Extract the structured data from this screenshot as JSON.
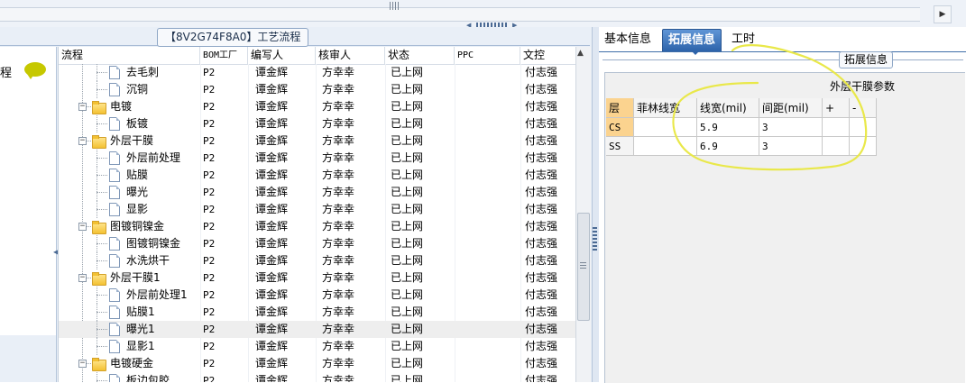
{
  "left_panel": {
    "title": "【8V2G74F8A0】工艺流程",
    "side_text": "程"
  },
  "grid": {
    "columns": [
      "流程",
      "BOM工厂",
      "编写人",
      "核审人",
      "状态",
      "PPC",
      "文控"
    ],
    "rows": [
      {
        "name": "去毛刺",
        "level": 2,
        "kind": "doc",
        "bom": "P2",
        "writer": "谭金辉",
        "reviewer": "方幸幸",
        "status": "已上网",
        "ppc": "",
        "control": "付志强"
      },
      {
        "name": "沉铜",
        "level": 2,
        "kind": "doc",
        "bom": "P2",
        "writer": "谭金辉",
        "reviewer": "方幸幸",
        "status": "已上网",
        "ppc": "",
        "control": "付志强"
      },
      {
        "name": "电镀",
        "level": 1,
        "kind": "folder",
        "bom": "P2",
        "writer": "谭金辉",
        "reviewer": "方幸幸",
        "status": "已上网",
        "ppc": "",
        "control": "付志强"
      },
      {
        "name": "板镀",
        "level": 2,
        "kind": "doc",
        "bom": "P2",
        "writer": "谭金辉",
        "reviewer": "方幸幸",
        "status": "已上网",
        "ppc": "",
        "control": "付志强"
      },
      {
        "name": "外层干膜",
        "level": 1,
        "kind": "folder",
        "bom": "P2",
        "writer": "谭金辉",
        "reviewer": "方幸幸",
        "status": "已上网",
        "ppc": "",
        "control": "付志强"
      },
      {
        "name": "外层前处理",
        "level": 2,
        "kind": "doc",
        "bom": "P2",
        "writer": "谭金辉",
        "reviewer": "方幸幸",
        "status": "已上网",
        "ppc": "",
        "control": "付志强"
      },
      {
        "name": "贴膜",
        "level": 2,
        "kind": "doc",
        "bom": "P2",
        "writer": "谭金辉",
        "reviewer": "方幸幸",
        "status": "已上网",
        "ppc": "",
        "control": "付志强"
      },
      {
        "name": "曝光",
        "level": 2,
        "kind": "doc",
        "bom": "P2",
        "writer": "谭金辉",
        "reviewer": "方幸幸",
        "status": "已上网",
        "ppc": "",
        "control": "付志强"
      },
      {
        "name": "显影",
        "level": 2,
        "kind": "doc",
        "bom": "P2",
        "writer": "谭金辉",
        "reviewer": "方幸幸",
        "status": "已上网",
        "ppc": "",
        "control": "付志强"
      },
      {
        "name": "图镀铜镍金",
        "level": 1,
        "kind": "folder",
        "bom": "P2",
        "writer": "谭金辉",
        "reviewer": "方幸幸",
        "status": "已上网",
        "ppc": "",
        "control": "付志强"
      },
      {
        "name": "图镀铜镍金",
        "level": 2,
        "kind": "doc",
        "bom": "P2",
        "writer": "谭金辉",
        "reviewer": "方幸幸",
        "status": "已上网",
        "ppc": "",
        "control": "付志强"
      },
      {
        "name": "水洗烘干",
        "level": 2,
        "kind": "doc",
        "bom": "P2",
        "writer": "谭金辉",
        "reviewer": "方幸幸",
        "status": "已上网",
        "ppc": "",
        "control": "付志强"
      },
      {
        "name": "外层干膜1",
        "level": 1,
        "kind": "folder",
        "bom": "P2",
        "writer": "谭金辉",
        "reviewer": "方幸幸",
        "status": "已上网",
        "ppc": "",
        "control": "付志强"
      },
      {
        "name": "外层前处理1",
        "level": 2,
        "kind": "doc",
        "bom": "P2",
        "writer": "谭金辉",
        "reviewer": "方幸幸",
        "status": "已上网",
        "ppc": "",
        "control": "付志强"
      },
      {
        "name": "贴膜1",
        "level": 2,
        "kind": "doc",
        "bom": "P2",
        "writer": "谭金辉",
        "reviewer": "方幸幸",
        "status": "已上网",
        "ppc": "",
        "control": "付志强"
      },
      {
        "name": "曝光1",
        "level": 2,
        "kind": "doc",
        "bom": "P2",
        "writer": "谭金辉",
        "reviewer": "方幸幸",
        "status": "已上网",
        "ppc": "",
        "control": "付志强",
        "selected": true
      },
      {
        "name": "显影1",
        "level": 2,
        "kind": "doc",
        "bom": "P2",
        "writer": "谭金辉",
        "reviewer": "方幸幸",
        "status": "已上网",
        "ppc": "",
        "control": "付志强"
      },
      {
        "name": "电镀硬金",
        "level": 1,
        "kind": "folder",
        "bom": "P2",
        "writer": "谭金辉",
        "reviewer": "方幸幸",
        "status": "已上网",
        "ppc": "",
        "control": "付志强"
      },
      {
        "name": "板边包胶",
        "level": 2,
        "kind": "doc",
        "bom": "P2",
        "writer": "谭金辉",
        "reviewer": "方幸幸",
        "status": "已上网",
        "ppc": "",
        "control": "付志强"
      }
    ]
  },
  "right_panel": {
    "tabs": [
      "基本信息",
      "拓展信息",
      "工时"
    ],
    "active_tab": 1,
    "group_label": "拓展信息",
    "param_title": "外层干膜参数",
    "param_headers": [
      "层",
      "菲林线宽",
      "线宽(mil)",
      "间距(mil)",
      "+",
      "-"
    ],
    "param_rows": [
      {
        "layer": "CS",
        "film_width": "",
        "line_width": "5.9",
        "spacing": "3"
      },
      {
        "layer": "SS",
        "film_width": "",
        "line_width": "6.9",
        "spacing": "3"
      }
    ]
  },
  "colors": {
    "accent": "#2d63aa",
    "annotation": "#e9e84a",
    "highlight": "#fbd38f",
    "panel": "#e9eff7"
  }
}
